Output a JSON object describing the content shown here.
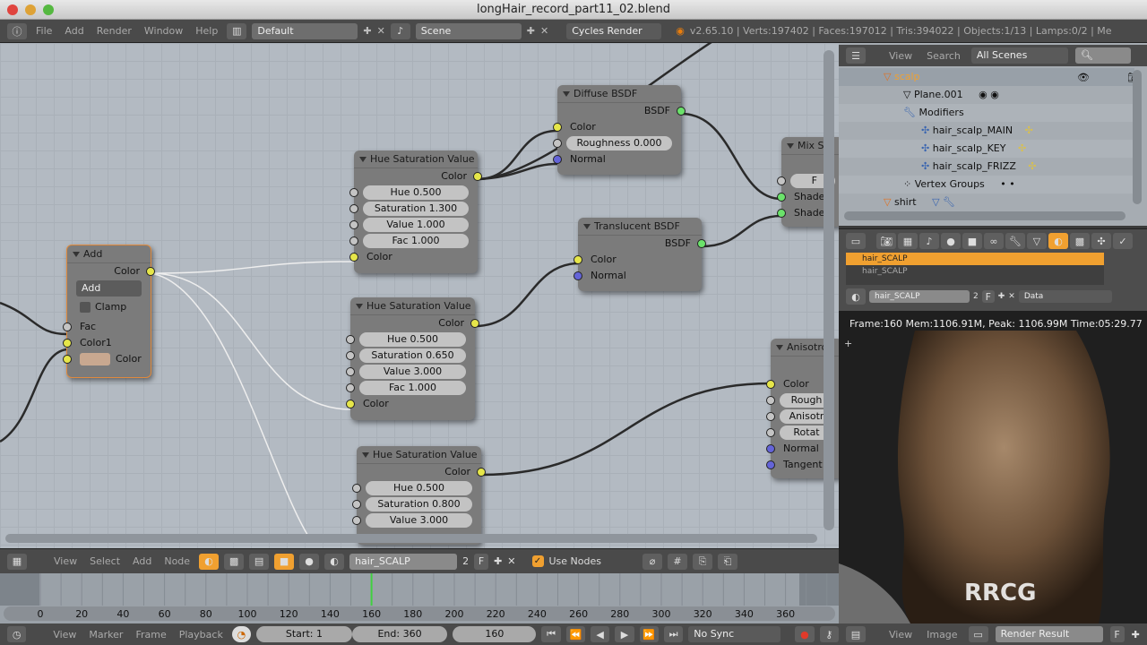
{
  "window": {
    "title": "longHair_record_part11_02.blend"
  },
  "infobar": {
    "menus": [
      "File",
      "Add",
      "Render",
      "Window",
      "Help"
    ],
    "layout": "Default",
    "scene": "Scene",
    "engine": "Cycles Render",
    "stats": "v2.65.10 | Verts:197402 | Faces:197012 | Tris:394022 | Objects:1/13 | Lamps:0/2 | Me"
  },
  "nodes": {
    "add": {
      "title": "Add",
      "output": "Color",
      "blend": "Add",
      "clamp": "Clamp",
      "inputs": [
        "Fac",
        "Color1",
        "Color"
      ],
      "swatch": "#c8a890"
    },
    "hsv1": {
      "title": "Hue Saturation Value",
      "output": "Color",
      "fields": [
        "Hue 0.500",
        "Saturation 1.300",
        "Value 1.000",
        "Fac 1.000"
      ],
      "input": "Color"
    },
    "hsv2": {
      "title": "Hue Saturation Value",
      "output": "Color",
      "fields": [
        "Hue 0.500",
        "Saturation 0.650",
        "Value 3.000",
        "Fac 1.000"
      ],
      "input": "Color"
    },
    "hsv3": {
      "title": "Hue Saturation Value",
      "output": "Color",
      "fields": [
        "Hue 0.500",
        "Saturation 0.800",
        "Value 3.000"
      ]
    },
    "diffuse": {
      "title": "Diffuse BSDF",
      "output": "BSDF",
      "color": "Color",
      "roughness": "Roughness 0.000",
      "normal": "Normal"
    },
    "translucent": {
      "title": "Translucent BSDF",
      "output": "BSDF",
      "color": "Color",
      "normal": "Normal"
    },
    "mix": {
      "title": "Mix S",
      "fac": "F",
      "shader1": "Shade",
      "shader2": "Shade"
    },
    "aniso": {
      "title": "Anisotro",
      "color": "Color",
      "roughness": "Rough",
      "anisotropy": "Anisotr",
      "rotation": "Rotat",
      "normal": "Normal",
      "tangent": "Tangent"
    }
  },
  "node_header": {
    "menus": [
      "View",
      "Select",
      "Add",
      "Node"
    ],
    "material": "hair_SCALP",
    "users": "2",
    "fake": "F",
    "use_nodes": "Use Nodes",
    "use_nodes_checked": true
  },
  "timeline": {
    "ticks": [
      "0",
      "20",
      "40",
      "60",
      "80",
      "100",
      "120",
      "140",
      "160",
      "180",
      "200",
      "220",
      "240",
      "260",
      "280",
      "300",
      "320",
      "340",
      "360"
    ],
    "current_frame": 160,
    "menus": [
      "View",
      "Marker",
      "Frame",
      "Playback"
    ],
    "start": "Start: 1",
    "end": "End: 360",
    "frame": "160",
    "sync": "No Sync"
  },
  "outliner": {
    "menus": [
      "View",
      "Search"
    ],
    "filter": "All Scenes",
    "items": [
      {
        "label": "scalp",
        "active": true
      },
      {
        "label": "Plane.001"
      },
      {
        "label": "Modifiers"
      },
      {
        "label": "hair_scalp_MAIN"
      },
      {
        "label": "hair_scalp_KEY"
      },
      {
        "label": "hair_scalp_FRIZZ"
      },
      {
        "label": "Vertex Groups"
      },
      {
        "label": "shirt"
      }
    ]
  },
  "properties": {
    "slots": [
      "hair_SCALP",
      "hair_SCALP"
    ],
    "material": "hair_SCALP",
    "users": "2",
    "fake": "F",
    "link": "Data"
  },
  "image_editor": {
    "status": "Frame:160 Mem:1106.91M, Peak: 1106.99M Time:05:29.77",
    "menus": [
      "View",
      "Image"
    ],
    "image": "Render Result",
    "fake": "F"
  },
  "watermark": "RRCG 人人素材",
  "colors": {
    "accent": "#f0a030",
    "selected_node": "#e08a3c",
    "current_frame": "#40d040"
  }
}
